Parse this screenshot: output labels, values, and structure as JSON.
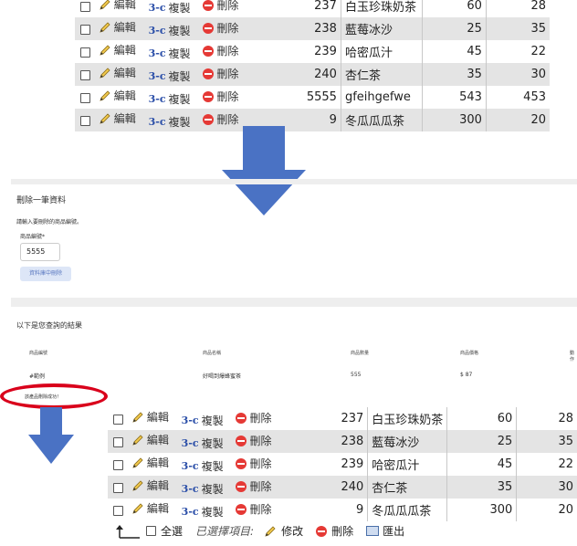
{
  "actions": {
    "edit": "編輯",
    "copy": "複製",
    "delete": "刪除",
    "copy_glyph": "3-c"
  },
  "top_table": {
    "rows": [
      {
        "id": "237",
        "name": "白玉珍珠奶茶",
        "qty": "60",
        "price": "28"
      },
      {
        "id": "238",
        "name": "藍莓冰沙",
        "qty": "25",
        "price": "35"
      },
      {
        "id": "239",
        "name": "哈密瓜汁",
        "qty": "45",
        "price": "22"
      },
      {
        "id": "240",
        "name": "杏仁茶",
        "qty": "35",
        "price": "30"
      },
      {
        "id": "5555",
        "name": "gfeihgefwe",
        "qty": "543",
        "price": "453"
      },
      {
        "id": "9",
        "name": "冬瓜瓜瓜茶",
        "qty": "300",
        "price": "20"
      }
    ]
  },
  "form": {
    "title": "刪除一筆資料",
    "hint": "請輸入要刪除的商品編號。",
    "label": "商品編號*",
    "value": "5555",
    "button": "資料庫中刪除"
  },
  "results": {
    "title": "以下是您查詢的結果",
    "headers": [
      "商品編號",
      "商品名稱",
      "商品數量",
      "商品價格",
      "動作"
    ],
    "values": [
      "#範例",
      "好喝到爆蜂蜜茶",
      "555",
      "$ 87"
    ],
    "success": "該產品刪除成功！"
  },
  "bottom_table": {
    "rows": [
      {
        "id": "237",
        "name": "白玉珍珠奶茶",
        "qty": "60",
        "price": "28"
      },
      {
        "id": "238",
        "name": "藍莓冰沙",
        "qty": "25",
        "price": "35"
      },
      {
        "id": "239",
        "name": "哈密瓜汁",
        "qty": "45",
        "price": "22"
      },
      {
        "id": "240",
        "name": "杏仁茶",
        "qty": "35",
        "price": "30"
      },
      {
        "id": "9",
        "name": "冬瓜瓜瓜茶",
        "qty": "300",
        "price": "20"
      }
    ]
  },
  "bottom_bar": {
    "select_all": "全選",
    "selected_label": "已選擇項目:",
    "modify": "修改",
    "delete": "刪除",
    "export": "匯出"
  },
  "colors": {
    "arrow": "#4a72c4",
    "oval": "#d9001b",
    "row_alt": "#e4e4e4"
  }
}
